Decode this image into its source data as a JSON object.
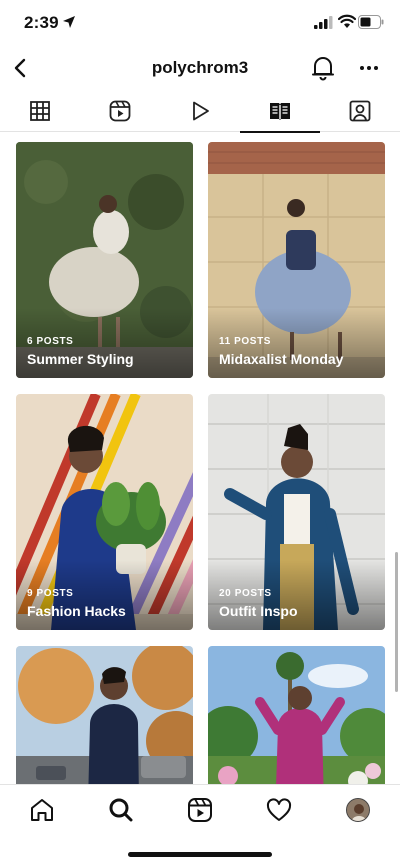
{
  "status_bar": {
    "time": "2:39"
  },
  "header": {
    "title": "polychrom3"
  },
  "tabs": [
    {
      "icon": "grid-icon",
      "active": false
    },
    {
      "icon": "reels-icon",
      "active": false
    },
    {
      "icon": "play-icon",
      "active": false
    },
    {
      "icon": "guides-icon",
      "active": true
    },
    {
      "icon": "tagged-icon",
      "active": false
    }
  ],
  "guides": [
    {
      "count": "6 POSTS",
      "name": "Summer Styling"
    },
    {
      "count": "11 POSTS",
      "name": "Midaxalist Monday"
    },
    {
      "count": "9 POSTS",
      "name": "Fashion Hacks"
    },
    {
      "count": "20 POSTS",
      "name": "Outfit Inspo"
    },
    {
      "count": "",
      "name": ""
    },
    {
      "count": "",
      "name": ""
    }
  ],
  "bottom_nav": [
    "home-icon",
    "search-icon",
    "reels-icon",
    "heart-icon",
    "profile-avatar"
  ],
  "colors": {
    "text": "#111111",
    "divider": "#e3e3e3"
  }
}
